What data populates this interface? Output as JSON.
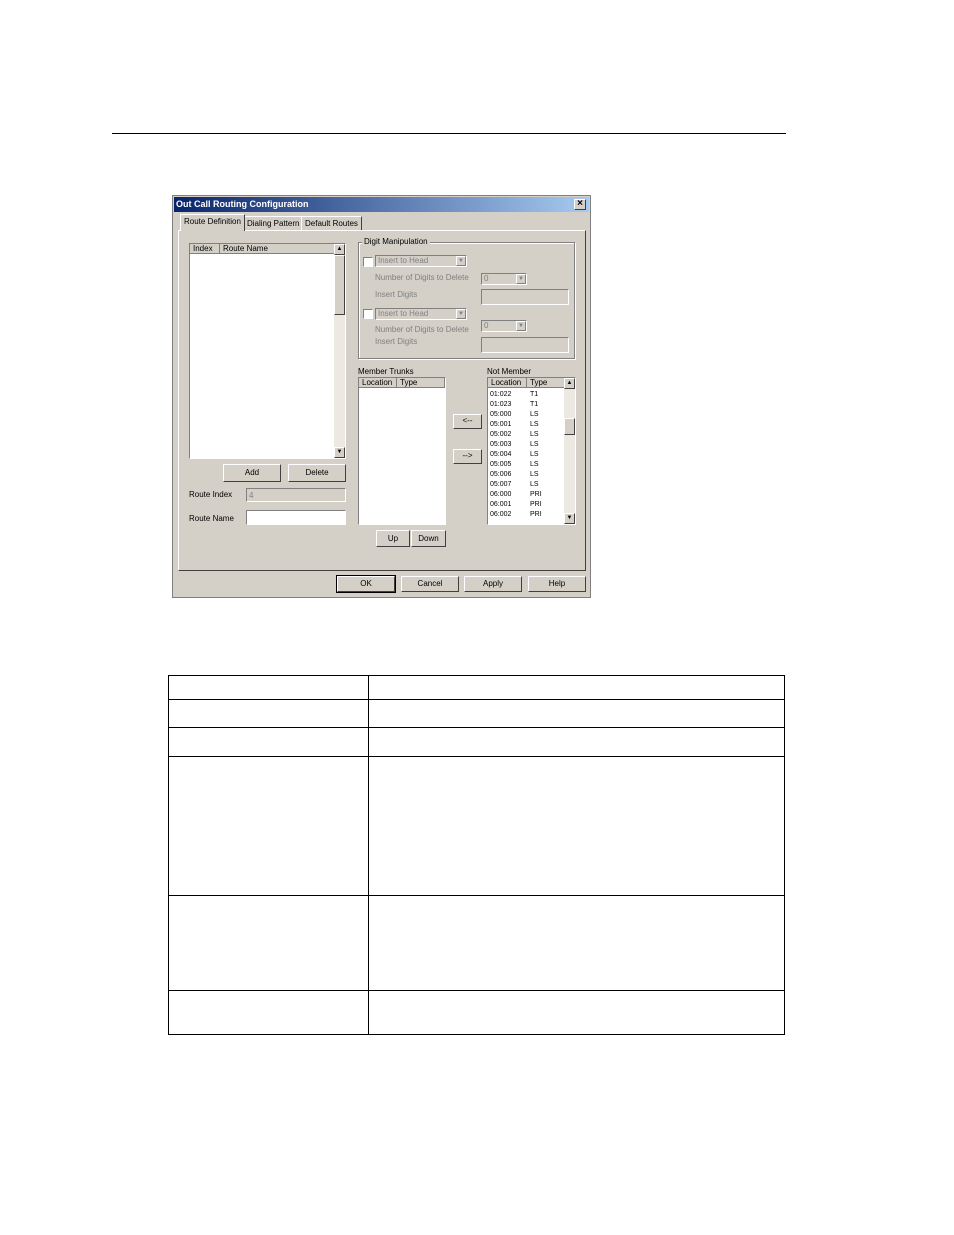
{
  "dialog": {
    "title": "Out Call Routing Configuration",
    "close_glyph": "×",
    "tabs": [
      {
        "label": "Route Definition",
        "active": true
      },
      {
        "label": "Dialing Pattern",
        "active": false
      },
      {
        "label": "Default Routes",
        "active": false
      }
    ],
    "route_list": {
      "columns": [
        "Index",
        "Route Name"
      ]
    },
    "add_label": "Add",
    "delete_label": "Delete",
    "route_index_label": "Route Index",
    "route_index_value": "4",
    "route_name_label": "Route Name",
    "route_name_value": "",
    "digit_manipulation": {
      "title": "Digit Manipulation",
      "blocks": [
        {
          "combo_value": "Insert to Head",
          "digits_to_delete_label": "Number of Digits to Delete",
          "digits_to_delete_value": "0",
          "insert_digits_label": "Insert Digits"
        },
        {
          "combo_value": "Insert to Head",
          "digits_to_delete_label": "Number of Digits to Delete",
          "digits_to_delete_value": "0",
          "insert_digits_label": "Insert Digits"
        }
      ]
    },
    "member_trunks": {
      "label": "Member Trunks",
      "columns": [
        "Location",
        "Type"
      ]
    },
    "not_member": {
      "label": "Not Member",
      "columns": [
        "Location",
        "Type"
      ],
      "rows": [
        {
          "location": "01:022",
          "type": "T1"
        },
        {
          "location": "01:023",
          "type": "T1"
        },
        {
          "location": "05:000",
          "type": "LS"
        },
        {
          "location": "05:001",
          "type": "LS"
        },
        {
          "location": "05:002",
          "type": "LS"
        },
        {
          "location": "05:003",
          "type": "LS"
        },
        {
          "location": "05:004",
          "type": "LS"
        },
        {
          "location": "05:005",
          "type": "LS"
        },
        {
          "location": "05:006",
          "type": "LS"
        },
        {
          "location": "05:007",
          "type": "LS"
        },
        {
          "location": "06:000",
          "type": "PRI"
        },
        {
          "location": "06:001",
          "type": "PRI"
        },
        {
          "location": "06:002",
          "type": "PRI"
        }
      ]
    },
    "move_left_label": "<--",
    "move_right_label": "-->",
    "up_label": "Up",
    "down_label": "Down",
    "ok_label": "OK",
    "cancel_label": "Cancel",
    "apply_label": "Apply",
    "help_label": "Help"
  }
}
